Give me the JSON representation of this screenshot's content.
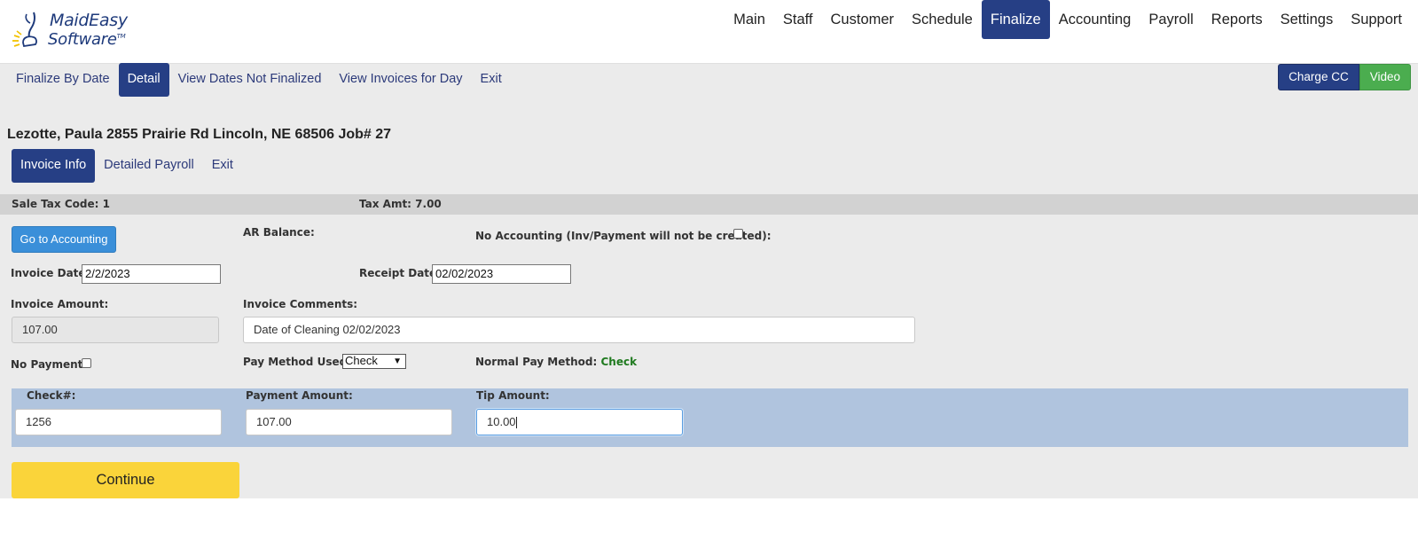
{
  "app": {
    "logo_line1": "MaidEasy",
    "logo_line2": "Software"
  },
  "topnav": {
    "items": [
      "Main",
      "Staff",
      "Customer",
      "Schedule",
      "Finalize",
      "Accounting",
      "Payroll",
      "Reports",
      "Settings",
      "Support"
    ],
    "active": "Finalize"
  },
  "subnav": {
    "items": [
      "Finalize By Date",
      "Detail",
      "View Dates Not Finalized",
      "View Invoices for Day",
      "Exit"
    ],
    "active": "Detail"
  },
  "buttons": {
    "charge_cc": "Charge CC",
    "video": "Video",
    "go_to_accounting": "Go to Accounting",
    "continue": "Continue"
  },
  "customer": {
    "title": "Lezotte, Paula 2855 Prairie Rd Lincoln, NE 68506 Job# 27"
  },
  "tabs": {
    "items": [
      "Invoice Info",
      "Detailed Payroll",
      "Exit"
    ],
    "active": "Invoice Info"
  },
  "tax": {
    "sale_tax_code": "Sale Tax Code: 1",
    "tax_amt": "Tax Amt: 7.00"
  },
  "form": {
    "ar_balance_label": "AR Balance:",
    "no_accounting_label": "No Accounting (Inv/Payment will not be created):",
    "no_accounting_checked": false,
    "invoice_date_label": "Invoice Date:",
    "invoice_date": "2/2/2023",
    "receipt_date_label": "Receipt Date:",
    "receipt_date": "02/02/2023",
    "invoice_amount_label": "Invoice Amount:",
    "invoice_amount": "107.00",
    "invoice_comments_label": "Invoice Comments:",
    "invoice_comments": "Date of Cleaning 02/02/2023",
    "no_payment_label": "No Payment:",
    "no_payment_checked": false,
    "pay_method_label": "Pay Method Used:",
    "pay_method": "Check",
    "normal_pay_method_label": "Normal Pay Method:",
    "normal_pay_method": "Check"
  },
  "payment": {
    "check_label": "Check#:",
    "check_number": "1256",
    "payment_amount_label": "Payment Amount:",
    "payment_amount": "107.00",
    "tip_amount_label": "Tip Amount:",
    "tip_amount": "10.00"
  },
  "colors": {
    "nav_active": "#263f85",
    "accounting_button": "#3a8fd9",
    "video_button": "#4bad4f",
    "continue_button": "#fad43a",
    "payment_panel": "#b0c4de",
    "normal_pay_method_text": "#1f7a1f"
  }
}
